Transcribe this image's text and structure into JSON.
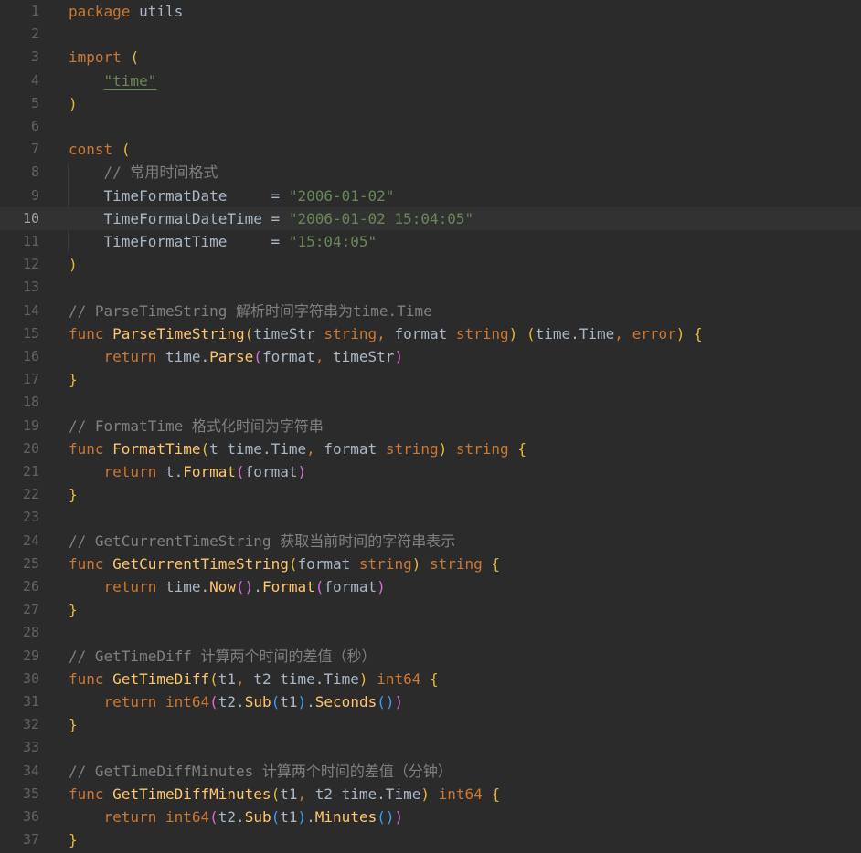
{
  "editor": {
    "language": "go",
    "current_line": 10,
    "colors": {
      "background": "#2b2b2b",
      "current_line_background": "#323232",
      "gutter_text": "#606366",
      "keyword": "#cc7832",
      "function": "#ffc66d",
      "string": "#6a8759",
      "comment": "#808080",
      "text": "#a9b7c6",
      "paren_level1": "#e8ba36",
      "paren_level2": "#d46fd6",
      "paren_level3": "#3c9ef0"
    },
    "lines": [
      {
        "number": "1",
        "tokens": [
          {
            "t": "package",
            "c": "kw"
          },
          {
            "t": " utils",
            "c": "tx"
          }
        ]
      },
      {
        "number": "2",
        "tokens": []
      },
      {
        "number": "3",
        "tokens": [
          {
            "t": "import",
            "c": "kw"
          },
          {
            "t": " ",
            "c": "tx"
          },
          {
            "t": "(",
            "c": "p1"
          }
        ]
      },
      {
        "number": "4",
        "tokens": [
          {
            "t": "    ",
            "c": "tx"
          },
          {
            "t": "\"time\"",
            "c": "str imp"
          }
        ]
      },
      {
        "number": "5",
        "tokens": [
          {
            "t": ")",
            "c": "p1"
          }
        ]
      },
      {
        "number": "6",
        "tokens": []
      },
      {
        "number": "7",
        "tokens": [
          {
            "t": "const",
            "c": "kw"
          },
          {
            "t": " ",
            "c": "tx"
          },
          {
            "t": "(",
            "c": "p1"
          }
        ]
      },
      {
        "number": "8",
        "tokens": [
          {
            "t": "    // 常用时间格式",
            "c": "cm"
          }
        ]
      },
      {
        "number": "9",
        "tokens": [
          {
            "t": "    TimeFormatDate     = ",
            "c": "tx"
          },
          {
            "t": "\"2006-01-02\"",
            "c": "str"
          }
        ]
      },
      {
        "number": "10",
        "tokens": [
          {
            "t": "    TimeFormatDateTime = ",
            "c": "tx"
          },
          {
            "t": "\"2006-01-02 15:04:05\"",
            "c": "str"
          }
        ]
      },
      {
        "number": "11",
        "tokens": [
          {
            "t": "    TimeFormatTime     = ",
            "c": "tx"
          },
          {
            "t": "\"15:04:05\"",
            "c": "str"
          }
        ]
      },
      {
        "number": "12",
        "tokens": [
          {
            "t": ")",
            "c": "p1"
          }
        ]
      },
      {
        "number": "13",
        "tokens": []
      },
      {
        "number": "14",
        "tokens": [
          {
            "t": "// ParseTimeString 解析时间字符串为time.Time",
            "c": "cm"
          }
        ]
      },
      {
        "number": "15",
        "tokens": [
          {
            "t": "func",
            "c": "kw"
          },
          {
            "t": " ",
            "c": "tx"
          },
          {
            "t": "ParseTimeString",
            "c": "fn"
          },
          {
            "t": "(",
            "c": "p1"
          },
          {
            "t": "timeStr ",
            "c": "tx"
          },
          {
            "t": "string",
            "c": "kw"
          },
          {
            "t": ",",
            "c": "kw"
          },
          {
            "t": " format ",
            "c": "tx"
          },
          {
            "t": "string",
            "c": "kw"
          },
          {
            "t": ")",
            "c": "p1"
          },
          {
            "t": " ",
            "c": "tx"
          },
          {
            "t": "(",
            "c": "p1"
          },
          {
            "t": "time.Time",
            "c": "tx"
          },
          {
            "t": ",",
            "c": "kw"
          },
          {
            "t": " ",
            "c": "tx"
          },
          {
            "t": "error",
            "c": "kw"
          },
          {
            "t": ")",
            "c": "p1"
          },
          {
            "t": " ",
            "c": "tx"
          },
          {
            "t": "{",
            "c": "p1"
          }
        ]
      },
      {
        "number": "16",
        "tokens": [
          {
            "t": "    ",
            "c": "tx"
          },
          {
            "t": "return",
            "c": "kw"
          },
          {
            "t": " time.",
            "c": "tx"
          },
          {
            "t": "Parse",
            "c": "fn"
          },
          {
            "t": "(",
            "c": "p2"
          },
          {
            "t": "format",
            "c": "tx"
          },
          {
            "t": ",",
            "c": "kw"
          },
          {
            "t": " timeStr",
            "c": "tx"
          },
          {
            "t": ")",
            "c": "p2"
          }
        ]
      },
      {
        "number": "17",
        "tokens": [
          {
            "t": "}",
            "c": "p1"
          }
        ]
      },
      {
        "number": "18",
        "tokens": []
      },
      {
        "number": "19",
        "tokens": [
          {
            "t": "// FormatTime 格式化时间为字符串",
            "c": "cm"
          }
        ]
      },
      {
        "number": "20",
        "tokens": [
          {
            "t": "func",
            "c": "kw"
          },
          {
            "t": " ",
            "c": "tx"
          },
          {
            "t": "FormatTime",
            "c": "fn"
          },
          {
            "t": "(",
            "c": "p1"
          },
          {
            "t": "t time.Time",
            "c": "tx"
          },
          {
            "t": ",",
            "c": "kw"
          },
          {
            "t": " format ",
            "c": "tx"
          },
          {
            "t": "string",
            "c": "kw"
          },
          {
            "t": ")",
            "c": "p1"
          },
          {
            "t": " ",
            "c": "tx"
          },
          {
            "t": "string",
            "c": "kw"
          },
          {
            "t": " ",
            "c": "tx"
          },
          {
            "t": "{",
            "c": "p1"
          }
        ]
      },
      {
        "number": "21",
        "tokens": [
          {
            "t": "    ",
            "c": "tx"
          },
          {
            "t": "return",
            "c": "kw"
          },
          {
            "t": " t.",
            "c": "tx"
          },
          {
            "t": "Format",
            "c": "fn"
          },
          {
            "t": "(",
            "c": "p2"
          },
          {
            "t": "format",
            "c": "tx"
          },
          {
            "t": ")",
            "c": "p2"
          }
        ]
      },
      {
        "number": "22",
        "tokens": [
          {
            "t": "}",
            "c": "p1"
          }
        ]
      },
      {
        "number": "23",
        "tokens": []
      },
      {
        "number": "24",
        "tokens": [
          {
            "t": "// GetCurrentTimeString 获取当前时间的字符串表示",
            "c": "cm"
          }
        ]
      },
      {
        "number": "25",
        "tokens": [
          {
            "t": "func",
            "c": "kw"
          },
          {
            "t": " ",
            "c": "tx"
          },
          {
            "t": "GetCurrentTimeString",
            "c": "fn"
          },
          {
            "t": "(",
            "c": "p1"
          },
          {
            "t": "format ",
            "c": "tx"
          },
          {
            "t": "string",
            "c": "kw"
          },
          {
            "t": ")",
            "c": "p1"
          },
          {
            "t": " ",
            "c": "tx"
          },
          {
            "t": "string",
            "c": "kw"
          },
          {
            "t": " ",
            "c": "tx"
          },
          {
            "t": "{",
            "c": "p1"
          }
        ]
      },
      {
        "number": "26",
        "tokens": [
          {
            "t": "    ",
            "c": "tx"
          },
          {
            "t": "return",
            "c": "kw"
          },
          {
            "t": " time.",
            "c": "tx"
          },
          {
            "t": "Now",
            "c": "fn"
          },
          {
            "t": "()",
            "c": "p2"
          },
          {
            "t": ".",
            "c": "tx"
          },
          {
            "t": "Format",
            "c": "fn"
          },
          {
            "t": "(",
            "c": "p2"
          },
          {
            "t": "format",
            "c": "tx"
          },
          {
            "t": ")",
            "c": "p2"
          }
        ]
      },
      {
        "number": "27",
        "tokens": [
          {
            "t": "}",
            "c": "p1"
          }
        ]
      },
      {
        "number": "28",
        "tokens": []
      },
      {
        "number": "29",
        "tokens": [
          {
            "t": "// GetTimeDiff 计算两个时间的差值（秒）",
            "c": "cm"
          }
        ]
      },
      {
        "number": "30",
        "tokens": [
          {
            "t": "func",
            "c": "kw"
          },
          {
            "t": " ",
            "c": "tx"
          },
          {
            "t": "GetTimeDiff",
            "c": "fn"
          },
          {
            "t": "(",
            "c": "p1"
          },
          {
            "t": "t1",
            "c": "tx"
          },
          {
            "t": ",",
            "c": "kw"
          },
          {
            "t": " t2 time.Time",
            "c": "tx"
          },
          {
            "t": ")",
            "c": "p1"
          },
          {
            "t": " ",
            "c": "tx"
          },
          {
            "t": "int64",
            "c": "kw"
          },
          {
            "t": " ",
            "c": "tx"
          },
          {
            "t": "{",
            "c": "p1"
          }
        ]
      },
      {
        "number": "31",
        "tokens": [
          {
            "t": "    ",
            "c": "tx"
          },
          {
            "t": "return",
            "c": "kw"
          },
          {
            "t": " ",
            "c": "tx"
          },
          {
            "t": "int64",
            "c": "kw"
          },
          {
            "t": "(",
            "c": "p2"
          },
          {
            "t": "t2.",
            "c": "tx"
          },
          {
            "t": "Sub",
            "c": "fn"
          },
          {
            "t": "(",
            "c": "p3"
          },
          {
            "t": "t1",
            "c": "tx"
          },
          {
            "t": ")",
            "c": "p3"
          },
          {
            "t": ".",
            "c": "tx"
          },
          {
            "t": "Seconds",
            "c": "fn"
          },
          {
            "t": "()",
            "c": "p3"
          },
          {
            "t": ")",
            "c": "p2"
          }
        ]
      },
      {
        "number": "32",
        "tokens": [
          {
            "t": "}",
            "c": "p1"
          }
        ]
      },
      {
        "number": "33",
        "tokens": []
      },
      {
        "number": "34",
        "tokens": [
          {
            "t": "// GetTimeDiffMinutes 计算两个时间的差值（分钟）",
            "c": "cm"
          }
        ]
      },
      {
        "number": "35",
        "tokens": [
          {
            "t": "func",
            "c": "kw"
          },
          {
            "t": " ",
            "c": "tx"
          },
          {
            "t": "GetTimeDiffMinutes",
            "c": "fn"
          },
          {
            "t": "(",
            "c": "p1"
          },
          {
            "t": "t1",
            "c": "tx"
          },
          {
            "t": ",",
            "c": "kw"
          },
          {
            "t": " t2 time.Time",
            "c": "tx"
          },
          {
            "t": ")",
            "c": "p1"
          },
          {
            "t": " ",
            "c": "tx"
          },
          {
            "t": "int64",
            "c": "kw"
          },
          {
            "t": " ",
            "c": "tx"
          },
          {
            "t": "{",
            "c": "p1"
          }
        ]
      },
      {
        "number": "36",
        "tokens": [
          {
            "t": "    ",
            "c": "tx"
          },
          {
            "t": "return",
            "c": "kw"
          },
          {
            "t": " ",
            "c": "tx"
          },
          {
            "t": "int64",
            "c": "kw"
          },
          {
            "t": "(",
            "c": "p2"
          },
          {
            "t": "t2.",
            "c": "tx"
          },
          {
            "t": "Sub",
            "c": "fn"
          },
          {
            "t": "(",
            "c": "p3"
          },
          {
            "t": "t1",
            "c": "tx"
          },
          {
            "t": ")",
            "c": "p3"
          },
          {
            "t": ".",
            "c": "tx"
          },
          {
            "t": "Minutes",
            "c": "fn"
          },
          {
            "t": "()",
            "c": "p3"
          },
          {
            "t": ")",
            "c": "p2"
          }
        ]
      },
      {
        "number": "37",
        "tokens": [
          {
            "t": "}",
            "c": "p1"
          }
        ]
      }
    ]
  }
}
